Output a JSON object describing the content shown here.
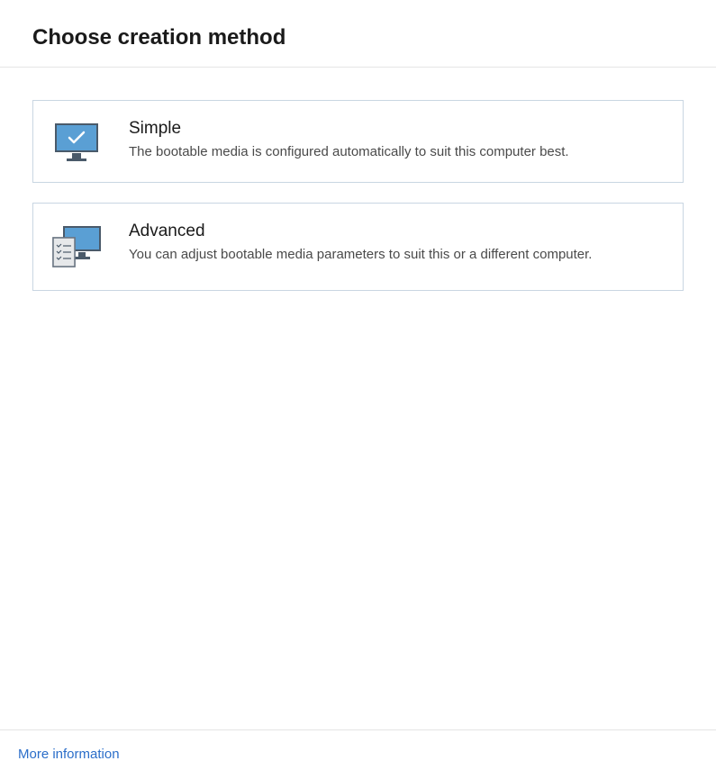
{
  "header": {
    "title": "Choose creation method"
  },
  "options": {
    "simple": {
      "title": "Simple",
      "description": "The bootable media is configured automatically to suit this computer best."
    },
    "advanced": {
      "title": "Advanced",
      "description": "You can adjust bootable media parameters to suit this or a different computer."
    }
  },
  "footer": {
    "more_info": "More information"
  }
}
